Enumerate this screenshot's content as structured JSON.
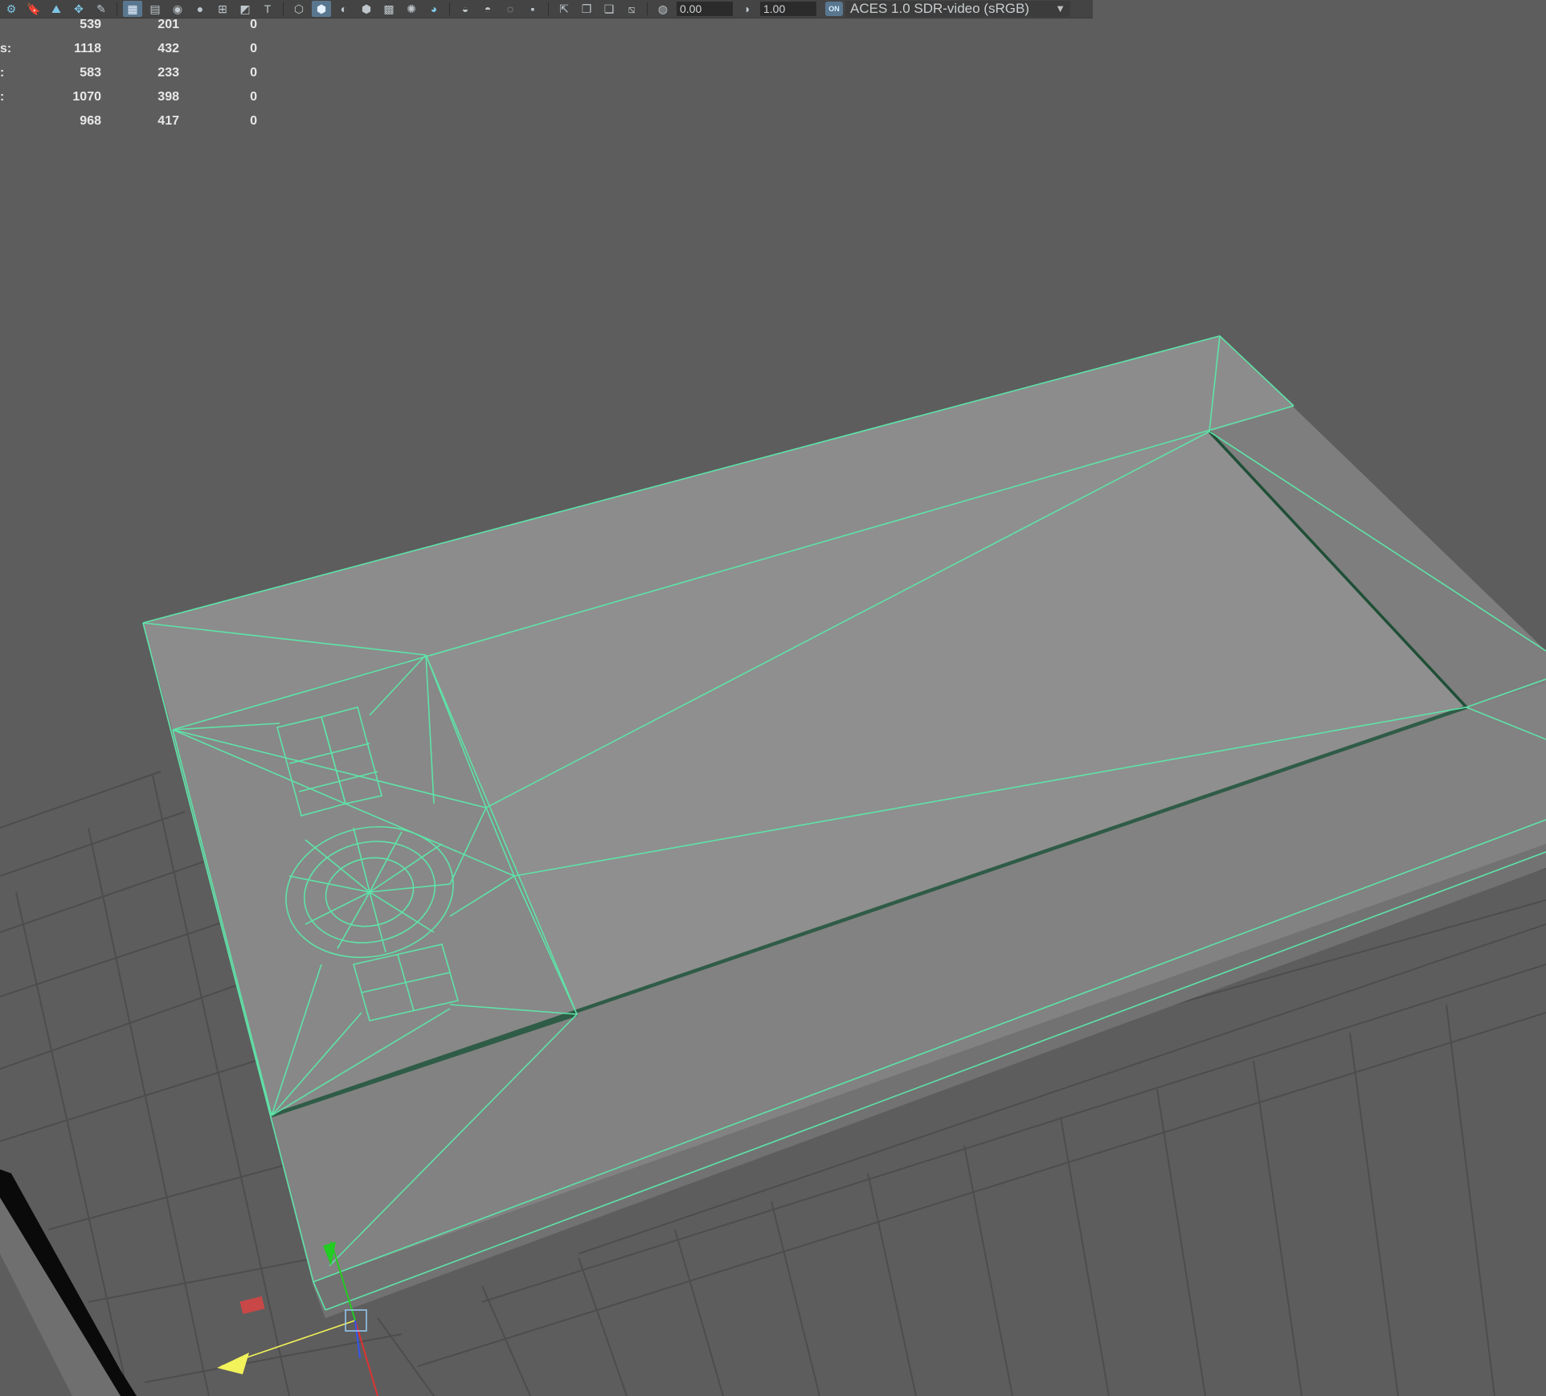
{
  "toolbar": {
    "exposure_value": "0.00",
    "gamma_value": "1.00",
    "color_mgmt_toggle": "ON",
    "color_space": "ACES 1.0 SDR-video (sRGB)"
  },
  "hud_stats": {
    "rows": [
      {
        "label": "",
        "a": "539",
        "b": "201",
        "c": "0"
      },
      {
        "label": "s:",
        "a": "1118",
        "b": "432",
        "c": "0"
      },
      {
        "label": ":",
        "a": "583",
        "b": "233",
        "c": "0"
      },
      {
        "label": ":",
        "a": "1070",
        "b": "398",
        "c": "0"
      },
      {
        "label": "",
        "a": "968",
        "b": "417",
        "c": "0"
      }
    ]
  },
  "colors": {
    "viewport_bg": "#5d5d5d",
    "grid_line": "#4a4a4a",
    "wireframe": "#5ee3a8",
    "mesh_face": "#8a8a8a",
    "gizmo_y": "#22cc22",
    "gizmo_x": "#dd3333",
    "gizmo_z": "#3355ee",
    "gizmo_pivot": "#f2f25a"
  },
  "icons": [
    "camera-icon",
    "bookmark-icon",
    "image-plane-icon",
    "2d-pan-icon",
    "grease-pencil-icon",
    "grid-icon",
    "film-gate-icon",
    "resolution-gate-icon",
    "gate-mask-icon",
    "field-chart-icon",
    "safe-action-icon",
    "safe-title-icon",
    "wireframe-icon",
    "smooth-shade-icon",
    "wireframe-on-shaded-icon",
    "default-material-icon",
    "textured-icon",
    "lighting-icon",
    "shadows-icon",
    "screen-space-ao-icon",
    "motion-blur-icon",
    "anti-aliasing-icon",
    "depth-of-field-icon",
    "isolate-select-icon",
    "xray-icon",
    "xray-active-components-icon",
    "xray-joints-icon",
    "exposure-icon",
    "gamma-icon",
    "color-management-icon"
  ]
}
